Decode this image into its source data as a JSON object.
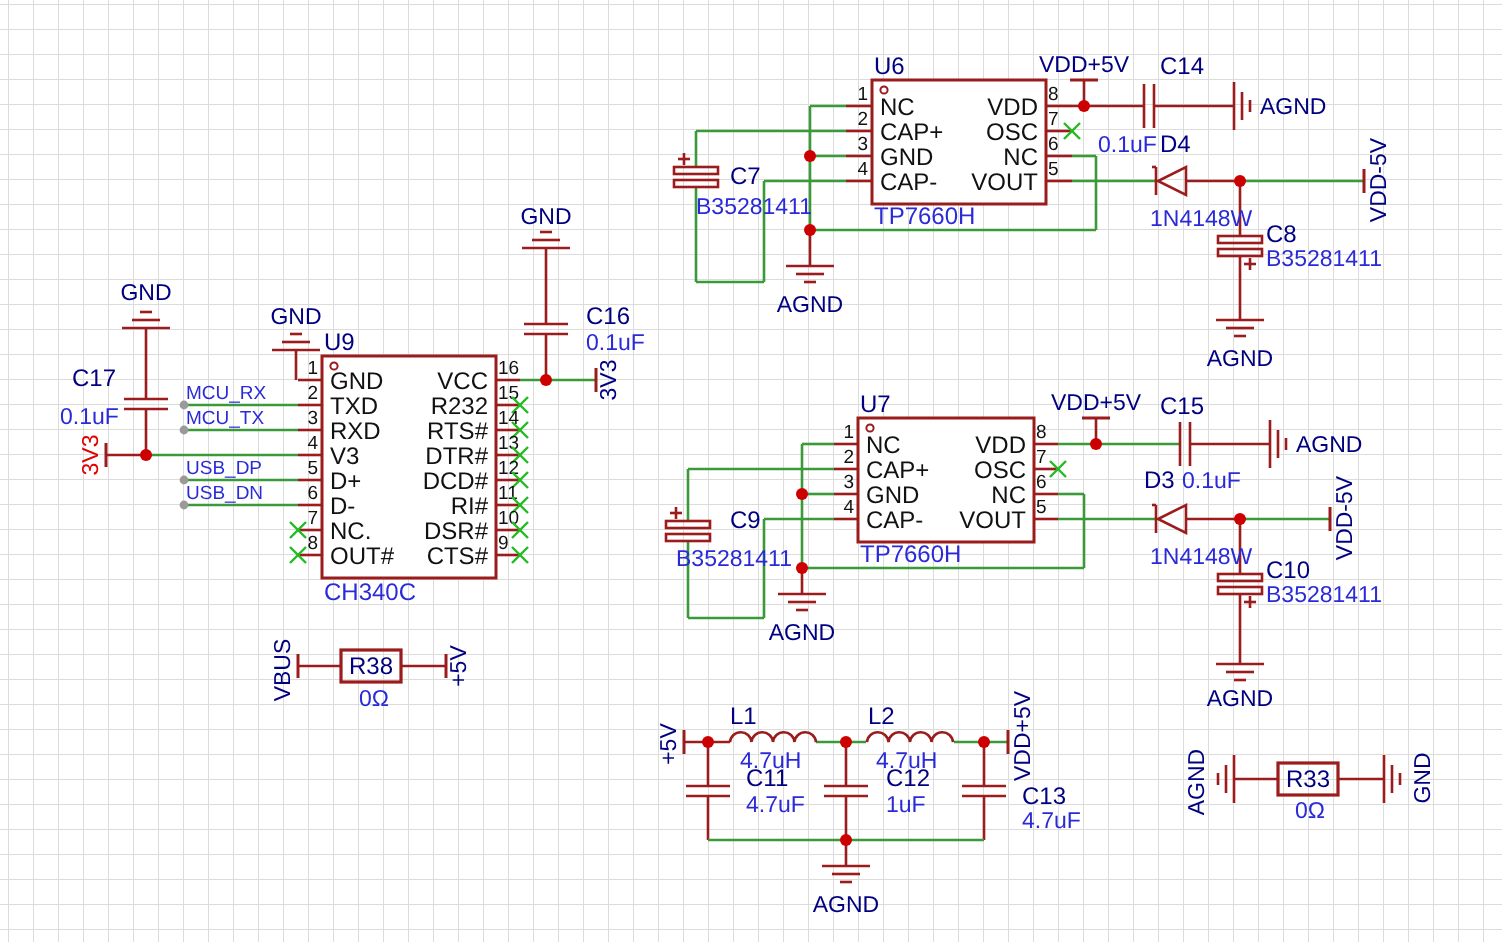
{
  "schematic": {
    "chips": [
      {
        "designator": "U9",
        "part": "CH340C",
        "pins_left": [
          {
            "number": "1",
            "name": "GND",
            "no_connect": false
          },
          {
            "number": "2",
            "name": "TXD",
            "no_connect": false
          },
          {
            "number": "3",
            "name": "RXD",
            "no_connect": false
          },
          {
            "number": "4",
            "name": "V3",
            "no_connect": false
          },
          {
            "number": "5",
            "name": "D+",
            "no_connect": false
          },
          {
            "number": "6",
            "name": "D-",
            "no_connect": false
          },
          {
            "number": "7",
            "name": "NC.",
            "no_connect": true
          },
          {
            "number": "8",
            "name": "OUT#",
            "no_connect": true
          }
        ],
        "pins_right": [
          {
            "number": "16",
            "name": "VCC",
            "no_connect": false
          },
          {
            "number": "15",
            "name": "R232",
            "no_connect": true
          },
          {
            "number": "14",
            "name": "RTS#",
            "no_connect": true
          },
          {
            "number": "13",
            "name": "DTR#",
            "no_connect": true
          },
          {
            "number": "12",
            "name": "DCD#",
            "no_connect": true
          },
          {
            "number": "11",
            "name": "RI#",
            "no_connect": true
          },
          {
            "number": "10",
            "name": "DSR#",
            "no_connect": true
          },
          {
            "number": "9",
            "name": "CTS#",
            "no_connect": true
          }
        ]
      },
      {
        "designator": "U6",
        "part": "TP7660H",
        "pins_left": [
          {
            "number": "1",
            "name": "NC",
            "no_connect": false
          },
          {
            "number": "2",
            "name": "CAP+",
            "no_connect": false
          },
          {
            "number": "3",
            "name": "GND",
            "no_connect": false
          },
          {
            "number": "4",
            "name": "CAP-",
            "no_connect": false
          }
        ],
        "pins_right": [
          {
            "number": "8",
            "name": "VDD",
            "no_connect": false
          },
          {
            "number": "7",
            "name": "OSC",
            "no_connect": true
          },
          {
            "number": "6",
            "name": "NC",
            "no_connect": false
          },
          {
            "number": "5",
            "name": "VOUT",
            "no_connect": false
          }
        ]
      },
      {
        "designator": "U7",
        "part": "TP7660H",
        "pins_left": [
          {
            "number": "1",
            "name": "NC",
            "no_connect": false
          },
          {
            "number": "2",
            "name": "CAP+",
            "no_connect": false
          },
          {
            "number": "3",
            "name": "GND",
            "no_connect": false
          },
          {
            "number": "4",
            "name": "CAP-",
            "no_connect": false
          }
        ],
        "pins_right": [
          {
            "number": "8",
            "name": "VDD",
            "no_connect": false
          },
          {
            "number": "7",
            "name": "OSC",
            "no_connect": true
          },
          {
            "number": "6",
            "name": "NC",
            "no_connect": false
          },
          {
            "number": "5",
            "name": "VOUT",
            "no_connect": false
          }
        ]
      }
    ],
    "parts": [
      {
        "kind": "capacitor",
        "designator": "C17",
        "value": "0.1uF"
      },
      {
        "kind": "capacitor",
        "designator": "C16",
        "value": "0.1uF"
      },
      {
        "kind": "capacitor",
        "designator": "C14",
        "value": "0.1uF"
      },
      {
        "kind": "polarized_capacitor",
        "designator": "C7",
        "value": "B35281411"
      },
      {
        "kind": "polarized_capacitor",
        "designator": "C8",
        "value": "B35281411"
      },
      {
        "kind": "diode",
        "designator": "D4",
        "value": "1N4148W"
      },
      {
        "kind": "capacitor",
        "designator": "C15",
        "value": "0.1uF"
      },
      {
        "kind": "polarized_capacitor",
        "designator": "C9",
        "value": "B35281411"
      },
      {
        "kind": "polarized_capacitor",
        "designator": "C10",
        "value": "B35281411"
      },
      {
        "kind": "diode",
        "designator": "D3",
        "value": "1N4148W"
      },
      {
        "kind": "resistor",
        "designator": "R38",
        "value": "0Ω"
      },
      {
        "kind": "inductor",
        "designator": "L1",
        "value": "4.7uH"
      },
      {
        "kind": "inductor",
        "designator": "L2",
        "value": "4.7uH"
      },
      {
        "kind": "capacitor",
        "designator": "C11",
        "value": "4.7uF"
      },
      {
        "kind": "capacitor",
        "designator": "C12",
        "value": "1uF"
      },
      {
        "kind": "capacitor",
        "designator": "C13",
        "value": "4.7uF"
      },
      {
        "kind": "resistor",
        "designator": "R33",
        "value": "0Ω"
      }
    ],
    "net_labels": [
      {
        "text": "MCU_RX"
      },
      {
        "text": "MCU_TX"
      },
      {
        "text": "USB_DP"
      },
      {
        "text": "USB_DN"
      }
    ],
    "power_ports": [
      {
        "kind": "ground",
        "net": "GND",
        "color": "#000080"
      },
      {
        "kind": "ground",
        "net": "GND",
        "color": "#000080"
      },
      {
        "kind": "ground",
        "net": "GND",
        "color": "#000080"
      },
      {
        "kind": "bar",
        "net": "3V3",
        "color": "#e00000"
      },
      {
        "kind": "bar",
        "net": "3V3",
        "color": "#000080"
      },
      {
        "kind": "bar",
        "net": "VDD+5V",
        "color": "#000080"
      },
      {
        "kind": "ground",
        "net": "AGND",
        "color": "#000080"
      },
      {
        "kind": "bar",
        "net": "VDD-5V",
        "color": "#000080"
      },
      {
        "kind": "ground",
        "net": "AGND",
        "color": "#000080"
      },
      {
        "kind": "ground",
        "net": "AGND",
        "color": "#000080"
      },
      {
        "kind": "bar",
        "net": "VDD+5V",
        "color": "#000080"
      },
      {
        "kind": "ground",
        "net": "AGND",
        "color": "#000080"
      },
      {
        "kind": "bar",
        "net": "VDD-5V",
        "color": "#000080"
      },
      {
        "kind": "ground",
        "net": "AGND",
        "color": "#000080"
      },
      {
        "kind": "ground",
        "net": "AGND",
        "color": "#000080"
      },
      {
        "kind": "bar",
        "net": "VBUS",
        "color": "#000080"
      },
      {
        "kind": "bar",
        "net": "+5V",
        "color": "#000080"
      },
      {
        "kind": "bar",
        "net": "+5V",
        "color": "#000080"
      },
      {
        "kind": "bar",
        "net": "VDD+5V",
        "color": "#000080"
      },
      {
        "kind": "ground",
        "net": "AGND",
        "color": "#000080"
      },
      {
        "kind": "ground",
        "net": "AGND",
        "color": "#000080"
      },
      {
        "kind": "ground",
        "net": "GND",
        "color": "#000080"
      }
    ]
  }
}
